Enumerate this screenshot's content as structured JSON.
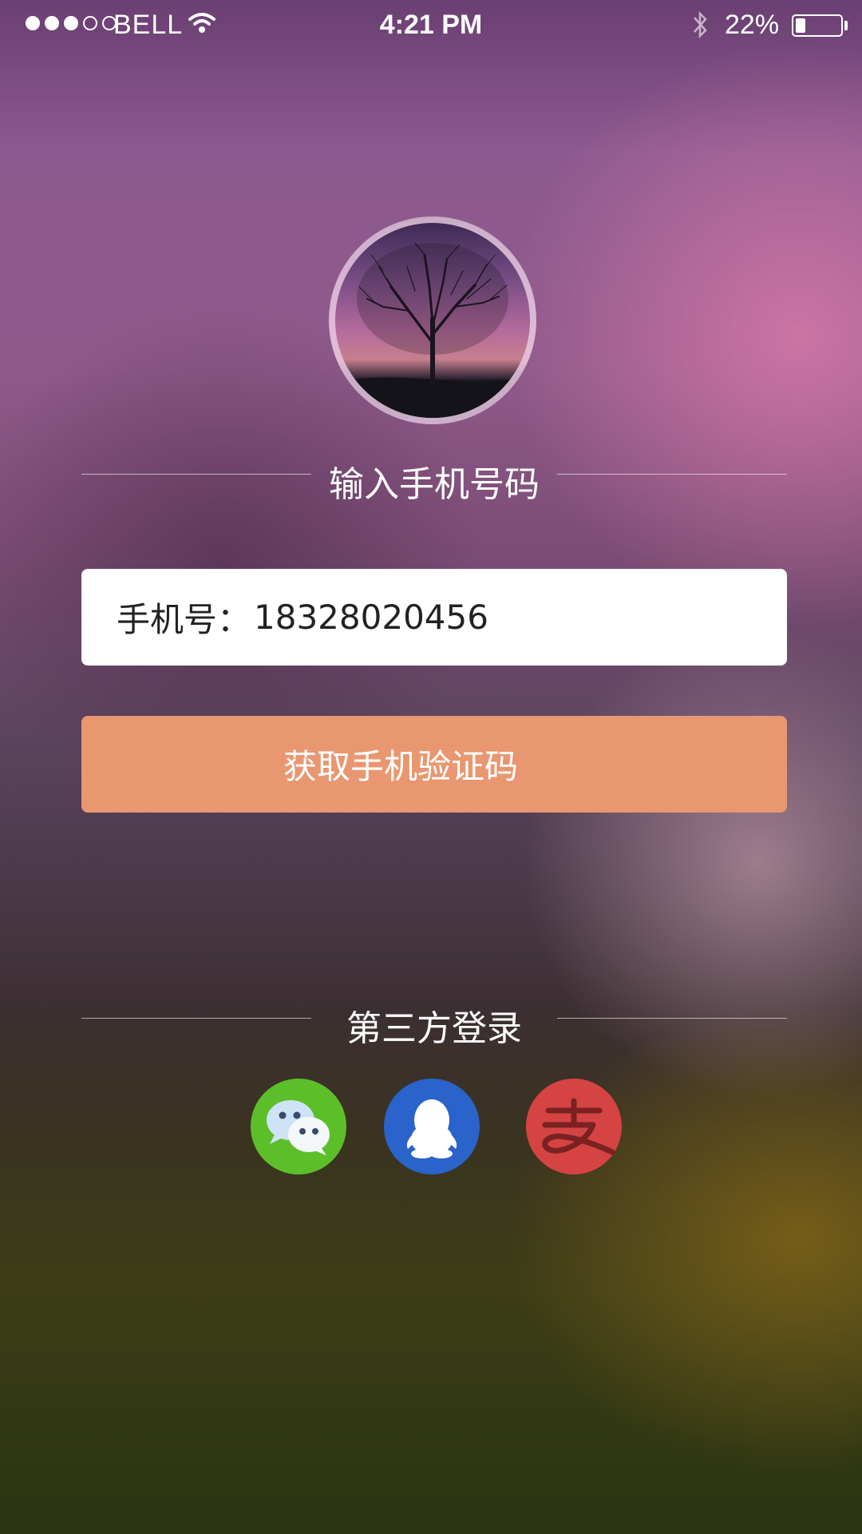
{
  "status_bar": {
    "carrier": "BELL",
    "time": "4:21 PM",
    "battery_percent": "22%",
    "battery_level": 0.22,
    "signal_strength": 3,
    "signal_max": 5
  },
  "avatar": {
    "icon": "tree-avatar-photo"
  },
  "phone_section": {
    "title": "输入手机号码",
    "field_label": "手机号：",
    "field_value": "18328020456",
    "get_code_button": "获取手机验证码"
  },
  "third_party": {
    "title": "第三方登录",
    "providers": [
      {
        "id": "wechat",
        "icon": "wechat-icon",
        "color": "#5cbf2a"
      },
      {
        "id": "qq",
        "icon": "qq-penguin-icon",
        "color": "#2a63c9"
      },
      {
        "id": "alipay",
        "icon": "alipay-icon",
        "color": "#d64343"
      }
    ]
  },
  "colors": {
    "accent_button": "#e99770"
  }
}
